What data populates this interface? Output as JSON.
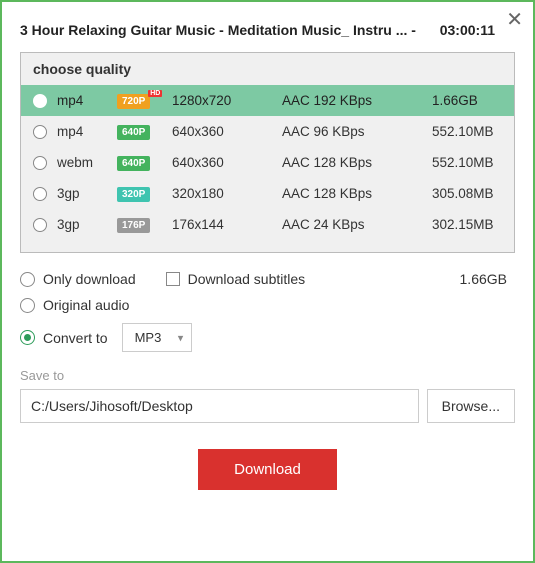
{
  "title": "3 Hour Relaxing Guitar Music - Meditation Music_ Instru ... -",
  "duration": "03:00:11",
  "quality_header": "choose quality",
  "qualities": [
    {
      "format": "mp4",
      "badge": "720P",
      "badge_class": "b-720",
      "hd": true,
      "resolution": "1280x720",
      "codec": "AAC 192 KBps",
      "size": "1.66GB",
      "selected": true
    },
    {
      "format": "mp4",
      "badge": "640P",
      "badge_class": "b-640",
      "hd": false,
      "resolution": "640x360",
      "codec": "AAC 96 KBps",
      "size": "552.10MB",
      "selected": false
    },
    {
      "format": "webm",
      "badge": "640P",
      "badge_class": "b-640",
      "hd": false,
      "resolution": "640x360",
      "codec": "AAC 128 KBps",
      "size": "552.10MB",
      "selected": false
    },
    {
      "format": "3gp",
      "badge": "320P",
      "badge_class": "b-320",
      "hd": false,
      "resolution": "320x180",
      "codec": "AAC 128 KBps",
      "size": "305.08MB",
      "selected": false
    },
    {
      "format": "3gp",
      "badge": "176P",
      "badge_class": "b-176",
      "hd": false,
      "resolution": "176x144",
      "codec": "AAC 24 KBps",
      "size": "302.15MB",
      "selected": false
    }
  ],
  "options": {
    "only_download": "Only download",
    "download_subtitles": "Download subtitles",
    "selected_size": "1.66GB",
    "original_audio": "Original audio",
    "convert_to": "Convert to",
    "convert_format": "MP3"
  },
  "save_to_label": "Save to",
  "save_path": "C:/Users/Jihosoft/Desktop",
  "browse_label": "Browse...",
  "download_label": "Download"
}
